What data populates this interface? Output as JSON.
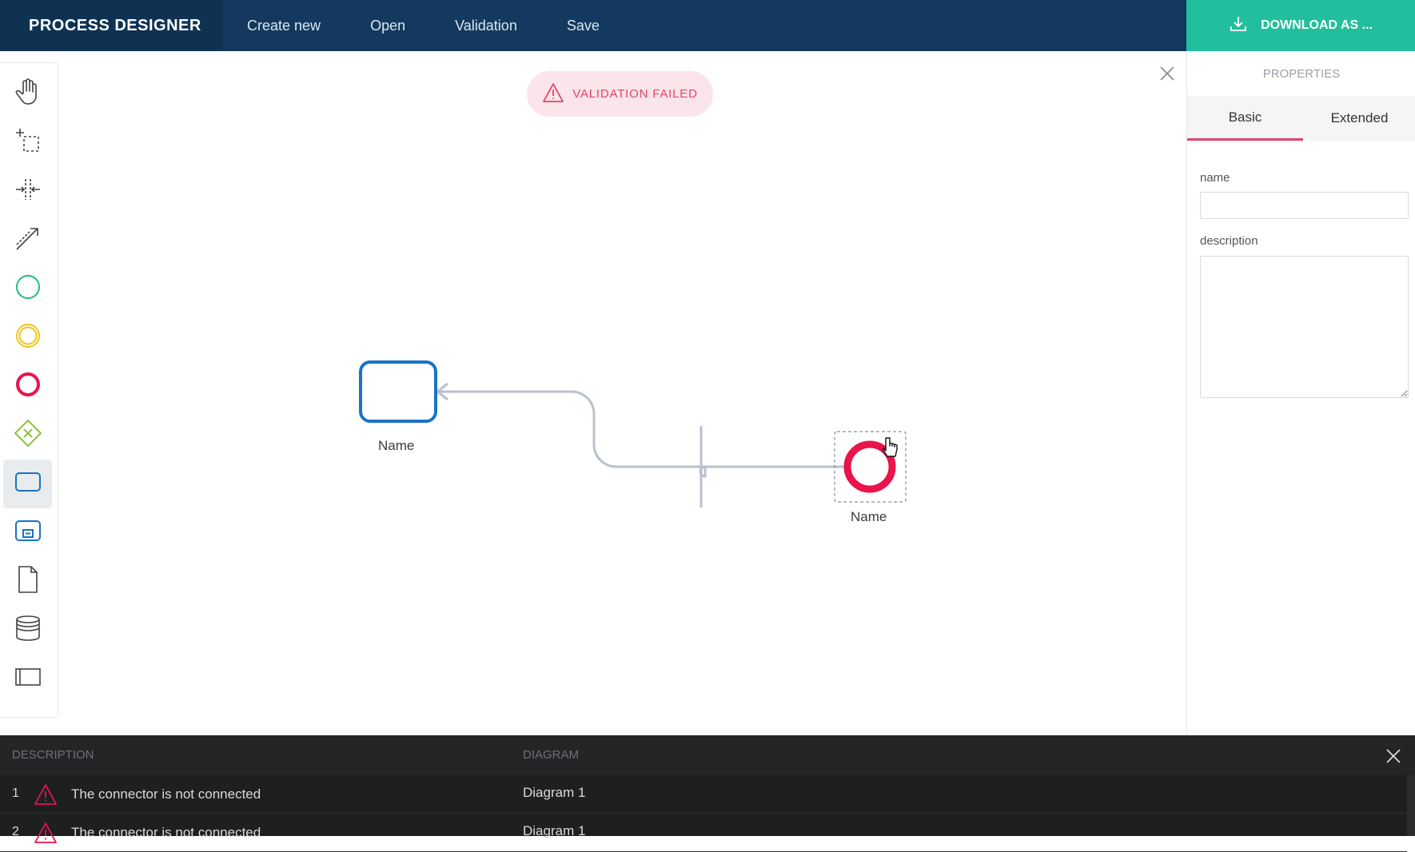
{
  "app": {
    "title": "PROCESS DESIGNER",
    "menu": [
      "Create new",
      "Open",
      "Validation",
      "Save"
    ],
    "download_label": "DOWNLOAD AS ..."
  },
  "colors": {
    "topbar": "#133a5e",
    "accent": "#21bf9d",
    "error": "#e0456d",
    "task_border": "#1a73c4"
  },
  "toolbox": {
    "tools": [
      {
        "name": "hand-tool",
        "icon": "hand-icon"
      },
      {
        "name": "lasso-tool",
        "icon": "lasso-select-icon"
      },
      {
        "name": "space-tool",
        "icon": "space-tool-icon"
      },
      {
        "name": "connect-tool",
        "icon": "connect-arrow-icon"
      },
      {
        "name": "start-event-tool",
        "icon": "start-event-icon"
      },
      {
        "name": "intermediate-event-tool",
        "icon": "intermediate-event-icon"
      },
      {
        "name": "end-event-tool",
        "icon": "end-event-icon"
      },
      {
        "name": "gateway-tool",
        "icon": "exclusive-gateway-icon"
      },
      {
        "name": "task-tool",
        "icon": "task-icon",
        "active": true
      },
      {
        "name": "subprocess-tool",
        "icon": "subprocess-icon"
      },
      {
        "name": "data-object-tool",
        "icon": "data-object-icon"
      },
      {
        "name": "data-store-tool",
        "icon": "data-store-icon"
      },
      {
        "name": "pool-tool",
        "icon": "pool-icon"
      }
    ]
  },
  "canvas": {
    "validation_message": "VALIDATION FAILED",
    "task_label": "Name",
    "end_event_label": "Name"
  },
  "properties": {
    "title": "PROPERTIES",
    "tabs": [
      "Basic",
      "Extended"
    ],
    "active_tab": "Basic",
    "name_label": "name",
    "name_value": "",
    "description_label": "description",
    "description_value": ""
  },
  "validation": {
    "columns": [
      "DESCRIPTION",
      "DIAGRAM"
    ],
    "rows": [
      {
        "num": "1",
        "description": "The connector is not connected",
        "diagram": "Diagram 1"
      },
      {
        "num": "2",
        "description": "The connector is not connected",
        "diagram": "Diagram 1"
      }
    ]
  }
}
